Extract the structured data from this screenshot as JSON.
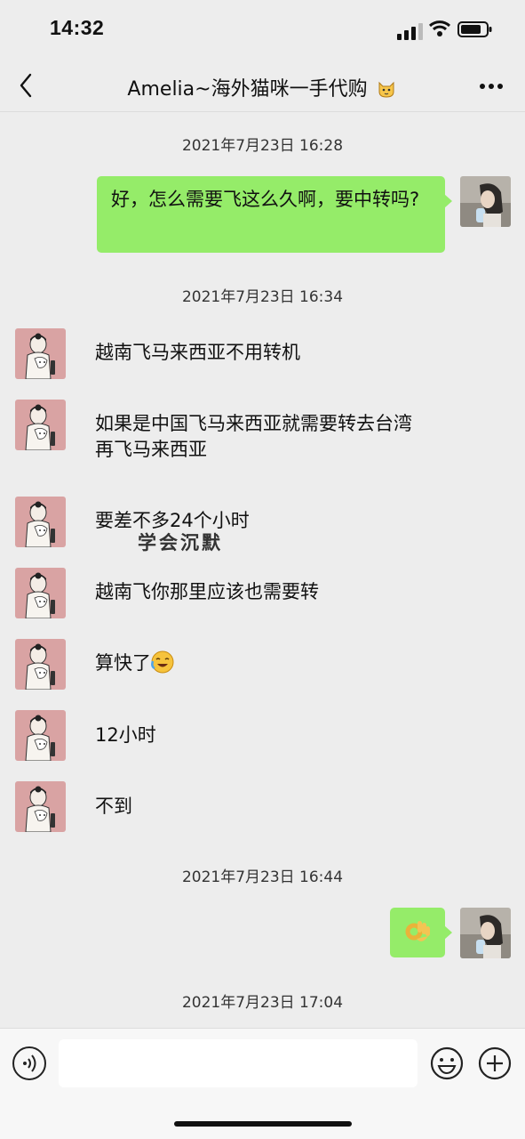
{
  "status_bar": {
    "time": "14:32"
  },
  "header": {
    "title": "Amelia~海外猫咪一手代购"
  },
  "messages": [
    {
      "type": "timestamp",
      "text": "2021年7月23日 16:28"
    },
    {
      "type": "sent",
      "text": "好，怎么需要飞这么久啊，要中转吗?"
    },
    {
      "type": "timestamp",
      "text": "2021年7月23日 16:34"
    },
    {
      "type": "received",
      "text": "越南飞马来西亚不用转机"
    },
    {
      "type": "received",
      "text": "如果是中国飞马来西亚就需要转去台湾再飞马来西亚"
    },
    {
      "type": "received",
      "text": "要差不多24个小时"
    },
    {
      "type": "received",
      "text": "越南飞你那里应该也需要转"
    },
    {
      "type": "received",
      "text": "算快了",
      "emoji": "laughing-tears-emoji"
    },
    {
      "type": "received",
      "text": "12小时"
    },
    {
      "type": "received",
      "text": "不到"
    },
    {
      "type": "timestamp",
      "text": "2021年7月23日 16:44"
    },
    {
      "type": "sent",
      "text": "",
      "emoji": "ok-hand-emoji"
    },
    {
      "type": "timestamp",
      "text": "2021年7月23日 17:04"
    }
  ],
  "overlay": {
    "text": "学会沉默"
  },
  "input_bar": {
    "placeholder": ""
  },
  "colors": {
    "background": "#ededed",
    "sent_bubble": "#95ec69",
    "received_avatar_bg": "#d9a3a3"
  },
  "icons": [
    "back-icon",
    "more-icon",
    "voice-icon",
    "emoji-face-icon",
    "plus-icon",
    "cat-emoji-icon"
  ]
}
